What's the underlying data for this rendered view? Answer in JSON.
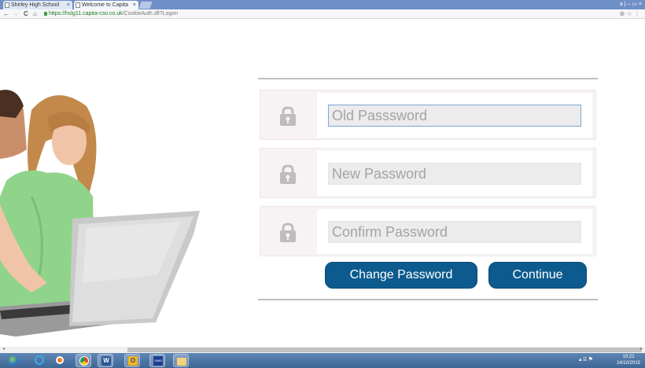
{
  "browser": {
    "tabs": [
      {
        "label": "Shirley High School",
        "close": "×"
      },
      {
        "label": "Welcome to Capita",
        "close": "×"
      }
    ],
    "window_controls": "a | – ▭ ×",
    "nav": {
      "back": "←",
      "forward": "→",
      "reload": "C",
      "home": "⌂"
    },
    "url_host": "https://hslg11.capita-cso.co.uk",
    "url_path": "/CookieAuth.dll?Logon",
    "zoom_icons": "⊕ ☆ ⋮"
  },
  "form": {
    "old_password": {
      "placeholder": "Old Passsword",
      "value": ""
    },
    "new_password": {
      "placeholder": "New Password",
      "value": ""
    },
    "confirm_password": {
      "placeholder": "Confirm Password",
      "value": ""
    },
    "change_button": "Change Password",
    "continue_button": "Continue"
  },
  "taskbar": {
    "items": [
      "start",
      "ie",
      "media",
      "chrome",
      "word",
      "outlook",
      "sims",
      "explorer"
    ],
    "sims_label": "SIMS",
    "tray": "▴ ⌸ ⚑",
    "time": "10:22",
    "date": "14/10/2015"
  },
  "colors": {
    "accent": "#0d5b8e",
    "row_bg": "#f7f3f5",
    "field_bg": "#ececec"
  }
}
